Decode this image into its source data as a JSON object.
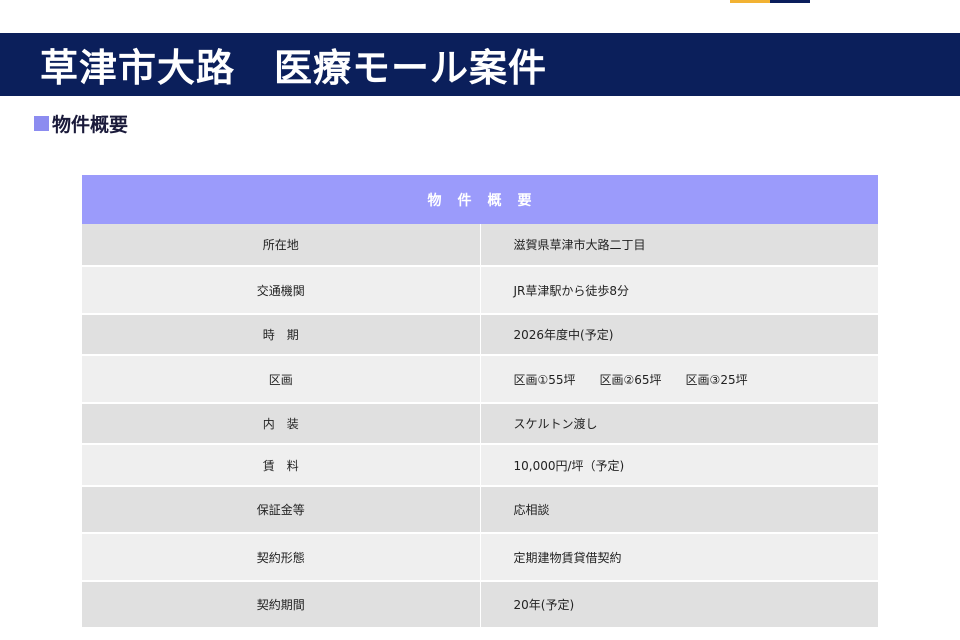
{
  "header": {
    "title": "草津市大路　医療モール案件",
    "accent_colors": [
      "#f2b233",
      "#0b1e5c"
    ]
  },
  "section": {
    "heading": "物件概要",
    "marker_color": "#8c8cf0"
  },
  "table": {
    "header": "物　件　概　要",
    "rows": [
      {
        "label": "所在地",
        "value": "滋賀県草津市大路二丁目"
      },
      {
        "label": "交通機関",
        "value": "JR草津駅から徒歩8分"
      },
      {
        "label": "時　期",
        "value": "2026年度中(予定)"
      },
      {
        "label": "区画",
        "value": "区画①55坪　　区画②65坪　　区画③25坪"
      },
      {
        "label": "内　装",
        "value": "スケルトン渡し"
      },
      {
        "label": "賃　料",
        "value": "10,000円/坪（予定)"
      },
      {
        "label": "保証金等",
        "value": "応相談"
      },
      {
        "label": "契約形態",
        "value": "定期建物賃貸借契約"
      },
      {
        "label": "契約期間",
        "value": "20年(予定)"
      }
    ]
  }
}
